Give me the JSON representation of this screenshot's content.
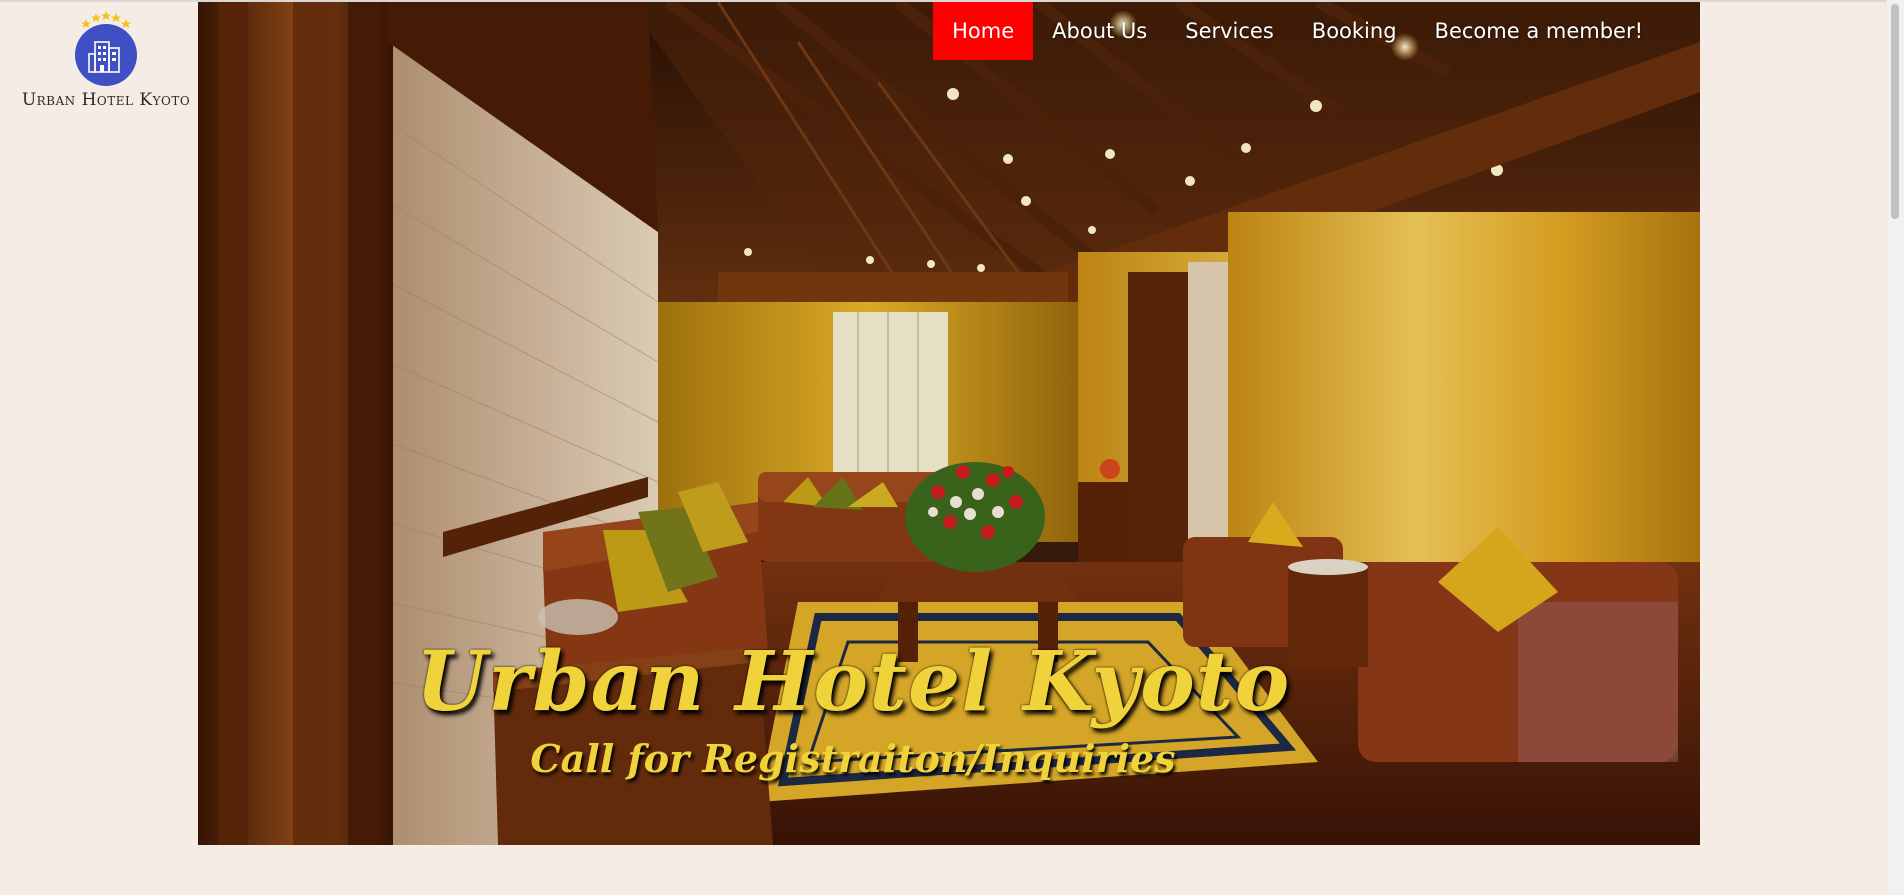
{
  "logo": {
    "name": "Urban Hotel Kyoto",
    "star_color": "#f2c21a",
    "circle_color": "#3f4fc4"
  },
  "nav": {
    "items": [
      {
        "label": "Home",
        "active": true
      },
      {
        "label": "About Us",
        "active": false
      },
      {
        "label": "Services",
        "active": false
      },
      {
        "label": "Booking",
        "active": false
      },
      {
        "label": "Become a member!",
        "active": false
      }
    ],
    "active_color": "#ff0000"
  },
  "hero": {
    "title": "Urban Hotel Kyoto",
    "subtitle": "Call for Registraiton/Inquiries",
    "text_color": "#f0d23a"
  },
  "colors": {
    "page_background": "#f5ece5"
  }
}
